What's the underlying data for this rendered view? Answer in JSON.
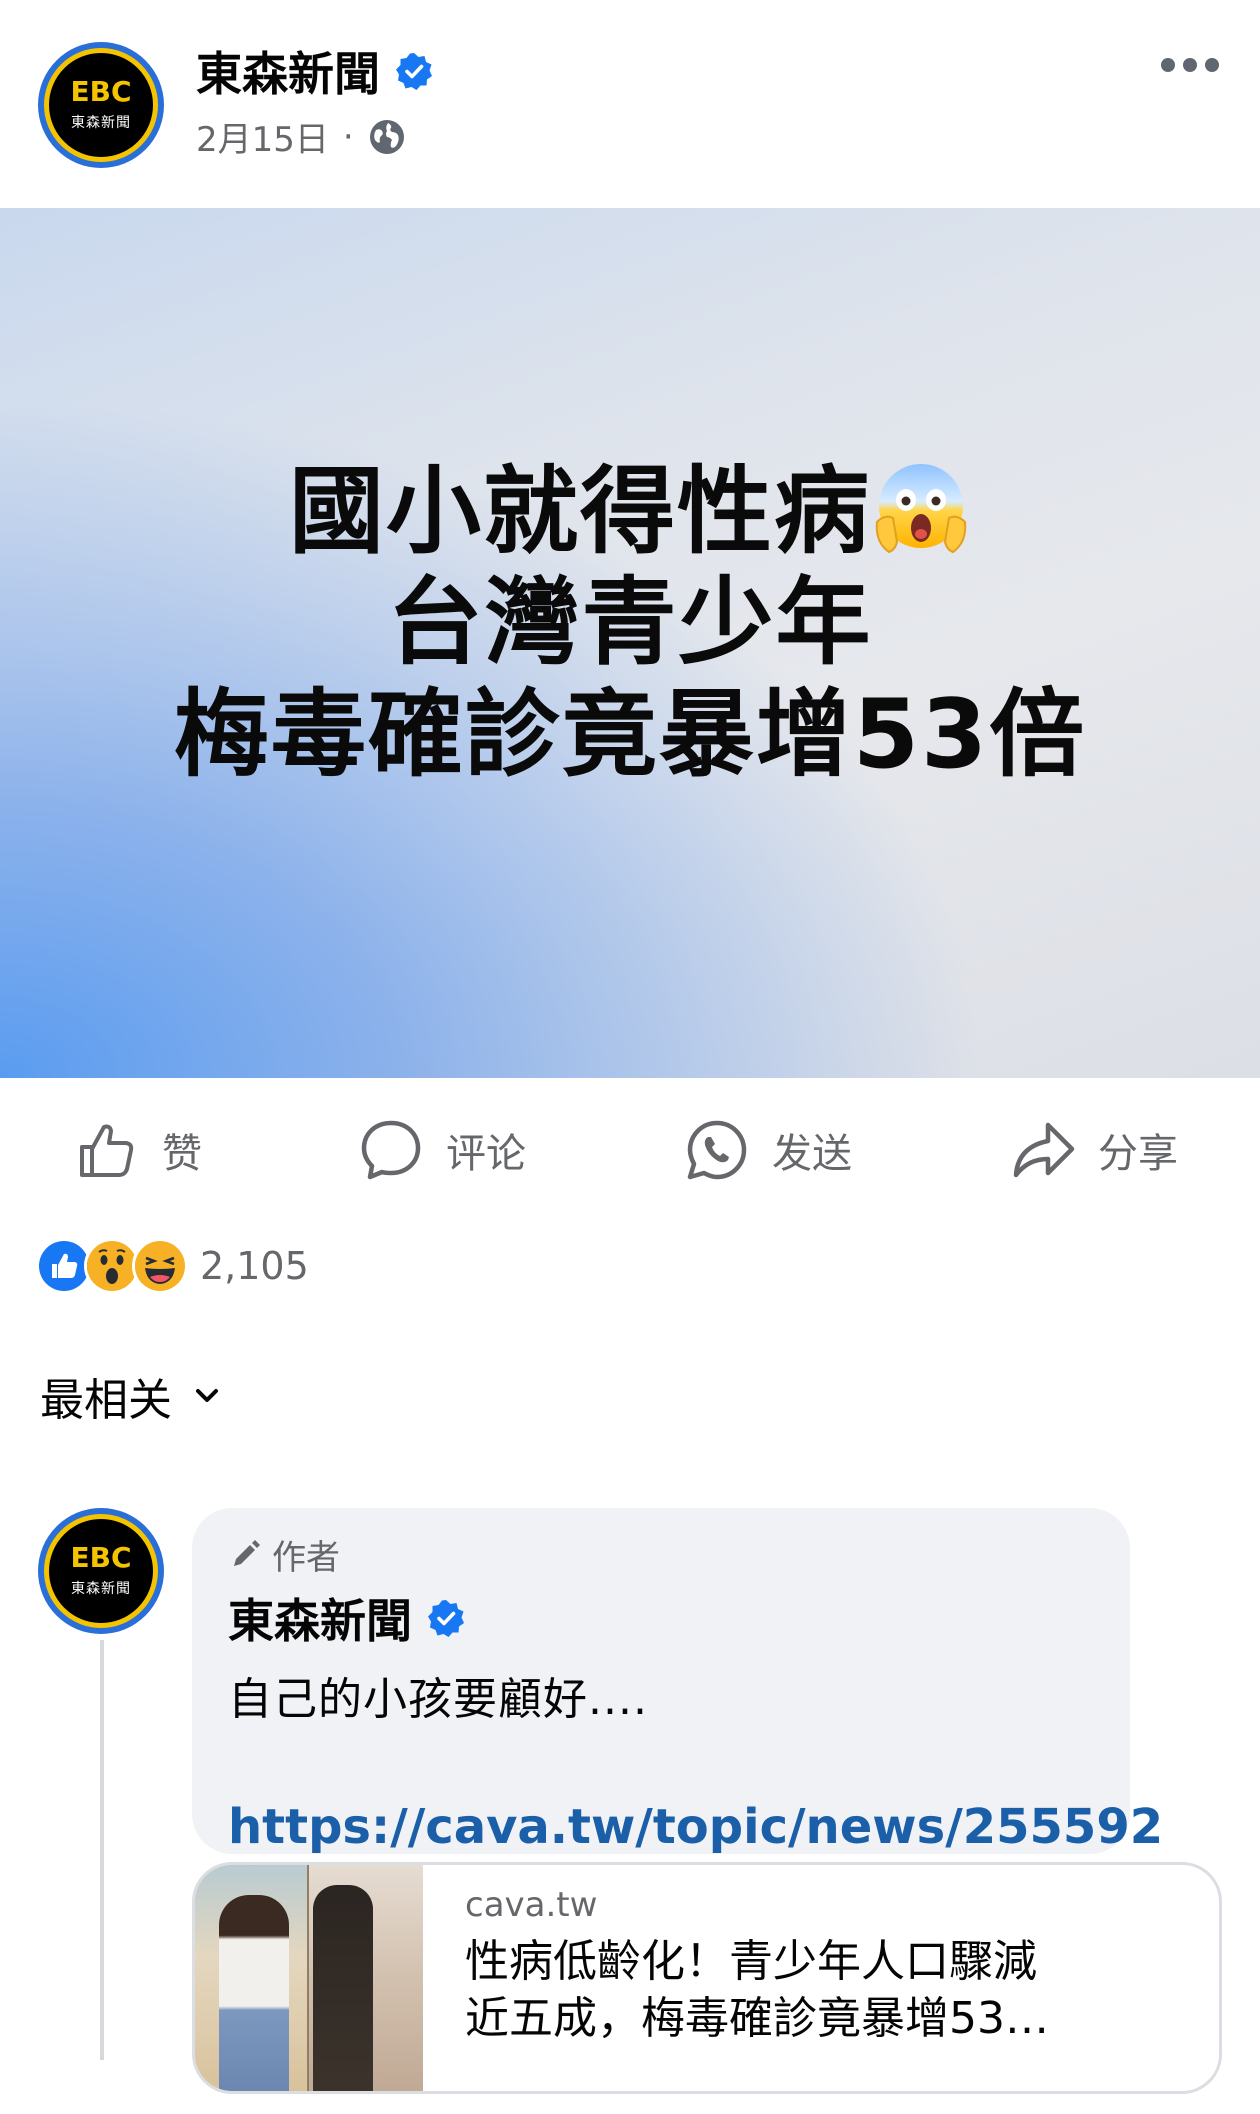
{
  "post": {
    "page_name": "東森新聞",
    "avatar_logo": "EBC",
    "avatar_sub": "東森新聞",
    "date": "2月15日",
    "separator": "·",
    "privacy_icon": "globe-icon",
    "more_icon": "more-options-icon"
  },
  "image": {
    "headline_line1": "國小就得性病",
    "headline_emoji": "face-screaming-in-fear",
    "headline_line2": "台灣青少年",
    "headline_line3": "梅毒確診竟暴增53倍"
  },
  "actions": {
    "like": "赞",
    "comment": "评论",
    "send": "发送",
    "share": "分享"
  },
  "reactions": {
    "types": [
      "like",
      "wow",
      "haha"
    ],
    "count": "2,105"
  },
  "sort": {
    "label": "最相关"
  },
  "comment": {
    "author_tag": "作者",
    "author_name": "東森新聞",
    "text": "自己的小孩要顧好....",
    "link": "https://cava.tw/topic/news/255592"
  },
  "link_preview": {
    "domain": "cava.tw",
    "title_line1": "性病低齡化！青少年人口驟減",
    "title_line2": "近五成，梅毒確診竟暴增53…"
  },
  "colors": {
    "text_primary": "#050505",
    "text_secondary": "#65676b",
    "verified_blue": "#1877f2",
    "link_blue": "#1b5fa8",
    "bubble_bg": "#f0f2f5"
  }
}
